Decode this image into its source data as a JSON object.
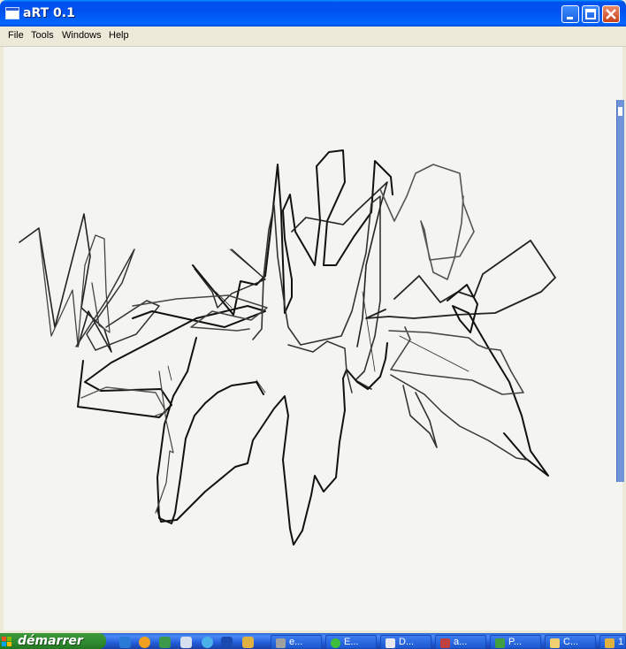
{
  "window": {
    "title": "aRT 0.1"
  },
  "menu": {
    "items": [
      "File",
      "Tools",
      "Windows",
      "Help"
    ]
  },
  "taskbar": {
    "start_label": "démarrer",
    "quick_launch_icons": [
      "internet-explorer-icon",
      "media-player-icon",
      "msn-icon",
      "mail-icon",
      "globe-icon",
      "eye-icon",
      "pen-icon"
    ],
    "tasks": [
      {
        "label": "e...",
        "icon": "tools-icon"
      },
      {
        "label": "E...",
        "icon": "green-circle-icon"
      },
      {
        "label": "D...",
        "icon": "document-icon"
      },
      {
        "label": "a...",
        "icon": "paint-icon"
      },
      {
        "label": "P...",
        "icon": "presentation-icon"
      },
      {
        "label": "C...",
        "icon": "folder-icon"
      },
      {
        "label": "1",
        "icon": "pen-icon"
      }
    ]
  },
  "colors": {
    "title_blue": "#0053ee",
    "canvas_bg": "#f4f4f1",
    "stroke_dark": "#111111",
    "stroke_gray": "#555555",
    "taskbar_blue": "#245edb",
    "start_green": "#2f8a2f"
  }
}
